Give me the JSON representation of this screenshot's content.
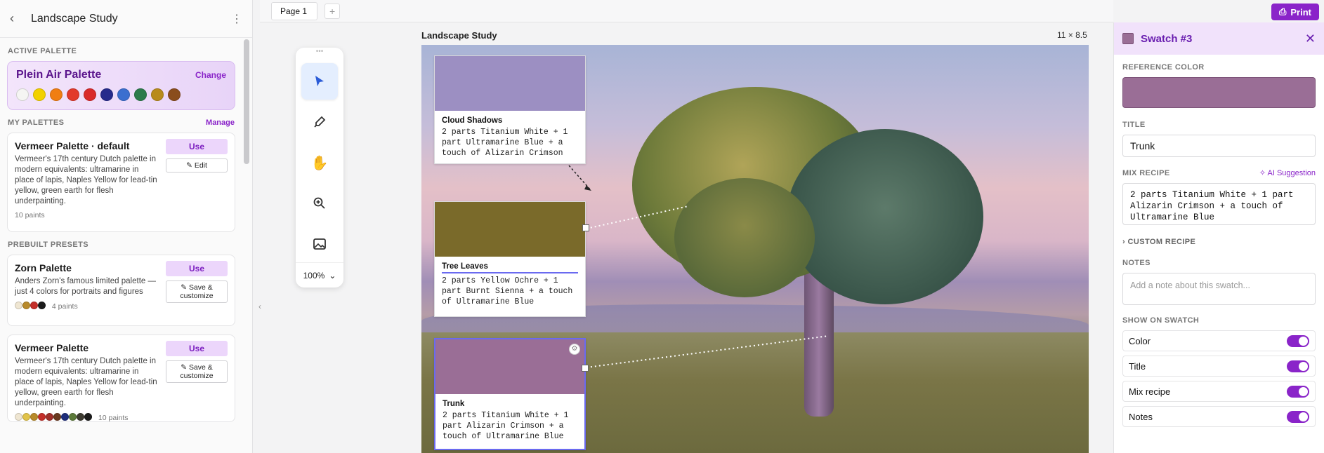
{
  "sidebar": {
    "title": "Landscape Study",
    "active_section": "ACTIVE PALETTE",
    "active_palette": {
      "name": "Plein Air Palette",
      "change": "Change",
      "colors": [
        "#f5f5f3",
        "#f2d100",
        "#f07e12",
        "#e23a2c",
        "#d92a2a",
        "#262b8c",
        "#3b6fcf",
        "#2c7b4b",
        "#b88b1c",
        "#8a4d1d"
      ]
    },
    "my_section": "MY PALETTES",
    "manage": "Manage",
    "my_palettes": [
      {
        "name": "Vermeer Palette · default",
        "desc": "Vermeer's 17th century Dutch palette in modern equivalents: ultramarine in place of lapis, Naples Yellow for lead-tin yellow, green earth for flesh underpainting.",
        "count": "10 paints",
        "use": "Use",
        "edit": "Edit"
      }
    ],
    "prebuilt_section": "PREBUILT PRESETS",
    "presets": [
      {
        "name": "Zorn Palette",
        "desc": "Anders Zorn's famous limited palette — just 4 colors for portraits and figures",
        "count": "4 paints",
        "colors": [
          "#efe6d2",
          "#b88a2a",
          "#c42f2a",
          "#1b1b1b"
        ],
        "use": "Use",
        "save": "Save & customize"
      },
      {
        "name": "Vermeer Palette",
        "desc": "Vermeer's 17th century Dutch palette in modern equivalents: ultramarine in place of lapis, Naples Yellow for lead-tin yellow, green earth for flesh underpainting.",
        "count": "10 paints",
        "colors": [
          "#efe6d2",
          "#e1c34a",
          "#b88a2a",
          "#c42f2a",
          "#a0302a",
          "#6b3a20",
          "#1e2d7a",
          "#5c7a3a",
          "#3d3a30",
          "#1b1b1b"
        ],
        "use": "Use",
        "save": "Save & customize"
      }
    ]
  },
  "tabs": {
    "page1": "Page 1",
    "add": "+"
  },
  "toolbar": {
    "zoom": "100%"
  },
  "canvas": {
    "title": "Landscape Study",
    "size": "11 × 8.5",
    "swatches": [
      {
        "title": "Cloud Shadows",
        "recipe": "2 parts Titanium White + 1 part Ultramarine Blue + a touch of Alizarin Crimson",
        "color": "#9c8fc2"
      },
      {
        "title": "Tree Leaves",
        "recipe": "2 parts Yellow Ochre + 1 part Burnt Sienna + a touch of Ultramarine Blue",
        "color": "#7a6a2a"
      },
      {
        "title": "Trunk",
        "recipe": "2 parts Titanium White + 1 part Alizarin Crimson + a touch of Ultramarine Blue",
        "color": "#9a6e96"
      }
    ]
  },
  "panel": {
    "title": "Swatch #3",
    "color": "#9a6e96",
    "reference_label": "REFERENCE COLOR",
    "title_label": "TITLE",
    "title_value": "Trunk",
    "recipe_label": "MIX RECIPE",
    "ai": "AI Suggestion",
    "recipe_value": "2 parts Titanium White + 1 part Alizarin Crimson + a touch of Ultramarine Blue",
    "custom_recipe": "CUSTOM RECIPE",
    "notes_label": "NOTES",
    "notes_placeholder": "Add a note about this swatch...",
    "show_label": "SHOW ON SWATCH",
    "toggles": [
      "Color",
      "Title",
      "Mix recipe",
      "Notes"
    ]
  },
  "header": {
    "print": "Print"
  }
}
